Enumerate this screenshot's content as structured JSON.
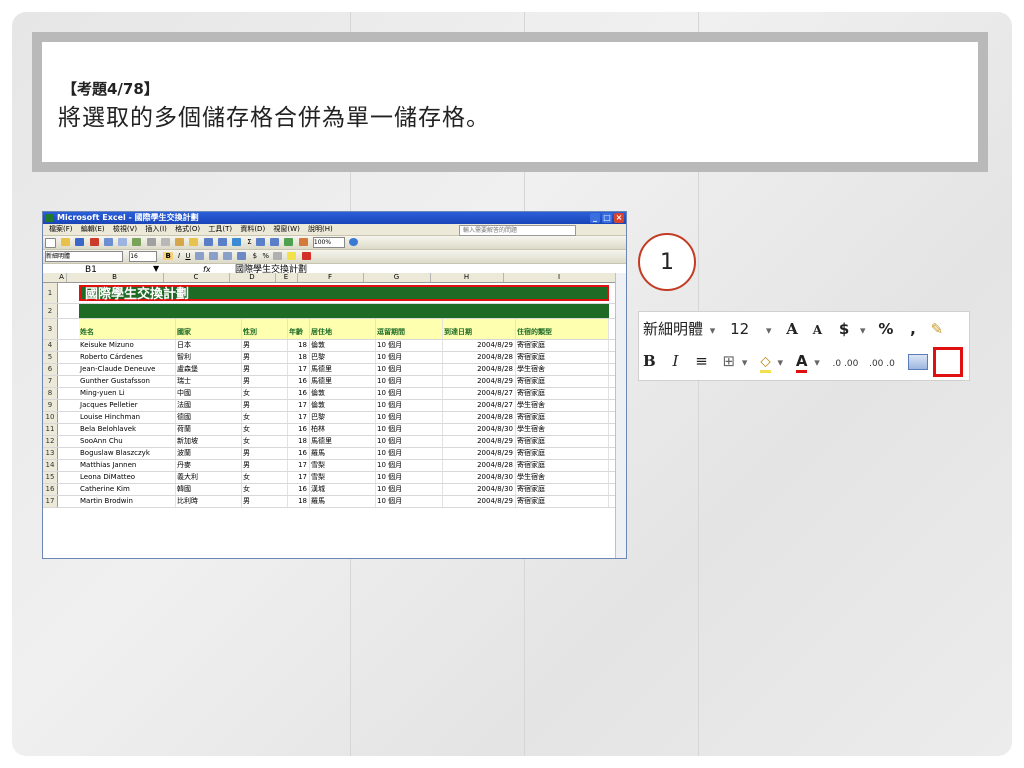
{
  "question": {
    "header": "【考題4/78】",
    "text": "將選取的多個儲存格合併為單一儲存格。"
  },
  "step_number": "1",
  "excel": {
    "window_title": "Microsoft Excel - 國際學生交換計劃",
    "menus": [
      "檔案(F)",
      "編輯(E)",
      "檢視(V)",
      "插入(I)",
      "格式(O)",
      "工具(T)",
      "資料(D)",
      "視窗(W)",
      "說明(H)"
    ],
    "help_placeholder": "輸入需要解答的問題",
    "zoom": "100%",
    "font_name": "新細明體",
    "font_size": "16",
    "name_box": "B1",
    "formula_fx": "fx",
    "formula_value": "國際學生交換計劃",
    "columns": [
      "A",
      "B",
      "C",
      "D",
      "E",
      "F",
      "G",
      "H",
      "I"
    ],
    "title_row": {
      "row": "1",
      "text": "國際學生交換計劃"
    },
    "empty_row": "2",
    "header_row": {
      "row": "3",
      "cells": [
        "姓名",
        "國家",
        "性別",
        "年齡",
        "居住地",
        "逗留期間",
        "到達日期",
        "住宿的類型"
      ]
    },
    "rows": [
      {
        "n": "4",
        "cells": [
          "Keisuke Mizuno",
          "日本",
          "男",
          "18",
          "倫敦",
          "10 個月",
          "2004/8/29",
          "寄宿家庭"
        ]
      },
      {
        "n": "5",
        "cells": [
          "Roberto Cárdenes",
          "智利",
          "男",
          "18",
          "巴黎",
          "10 個月",
          "2004/8/28",
          "寄宿家庭"
        ]
      },
      {
        "n": "6",
        "cells": [
          "Jean-Claude Deneuve",
          "盧森堡",
          "男",
          "17",
          "馬德里",
          "10 個月",
          "2004/8/28",
          "學生宿舍"
        ]
      },
      {
        "n": "7",
        "cells": [
          "Gunther Gustafsson",
          "瑞士",
          "男",
          "16",
          "馬德里",
          "10 個月",
          "2004/8/29",
          "寄宿家庭"
        ]
      },
      {
        "n": "8",
        "cells": [
          "Ming-yuen Li",
          "中國",
          "女",
          "16",
          "倫敦",
          "10 個月",
          "2004/8/27",
          "寄宿家庭"
        ]
      },
      {
        "n": "9",
        "cells": [
          "Jacques Pelletier",
          "法國",
          "男",
          "17",
          "倫敦",
          "10 個月",
          "2004/8/27",
          "學生宿舍"
        ]
      },
      {
        "n": "10",
        "cells": [
          "Louise Hinchman",
          "德國",
          "女",
          "17",
          "巴黎",
          "10 個月",
          "2004/8/28",
          "寄宿家庭"
        ]
      },
      {
        "n": "11",
        "cells": [
          "Bela Belohlavek",
          "荷蘭",
          "女",
          "16",
          "柏林",
          "10 個月",
          "2004/8/30",
          "學生宿舍"
        ]
      },
      {
        "n": "12",
        "cells": [
          "SooAnn Chu",
          "新加坡",
          "女",
          "18",
          "馬德里",
          "10 個月",
          "2004/8/29",
          "寄宿家庭"
        ]
      },
      {
        "n": "13",
        "cells": [
          "Boguslaw Blaszczyk",
          "波蘭",
          "男",
          "16",
          "羅馬",
          "10 個月",
          "2004/8/29",
          "寄宿家庭"
        ]
      },
      {
        "n": "14",
        "cells": [
          "Matthias Jannen",
          "丹麥",
          "男",
          "17",
          "雪梨",
          "10 個月",
          "2004/8/28",
          "寄宿家庭"
        ]
      },
      {
        "n": "15",
        "cells": [
          "Leona DiMatteo",
          "義大利",
          "女",
          "17",
          "雪梨",
          "10 個月",
          "2004/8/30",
          "學生宿舍"
        ]
      },
      {
        "n": "16",
        "cells": [
          "Catherine Kim",
          "韓國",
          "女",
          "16",
          "漢城",
          "10 個月",
          "2004/8/30",
          "寄宿家庭"
        ]
      },
      {
        "n": "17",
        "cells": [
          "Martin Brodwin",
          "比利時",
          "男",
          "18",
          "羅馬",
          "10 個月",
          "2004/8/29",
          "寄宿家庭"
        ]
      }
    ]
  },
  "toolbar_zoom": {
    "font_name": "新細明體",
    "font_size": "12",
    "grow_font": "A",
    "shrink_font": "A",
    "currency": "$",
    "percent": "%",
    "comma": ",",
    "bold": "B",
    "italic": "I",
    "font_color_letter": "A",
    "increase_decimal": ".0 .00",
    "decrease_decimal": ".00 .0"
  },
  "colors": {
    "title_green": "#1e6b26",
    "header_yellow": "#ffffb0",
    "highlight_red": "#e01010"
  }
}
